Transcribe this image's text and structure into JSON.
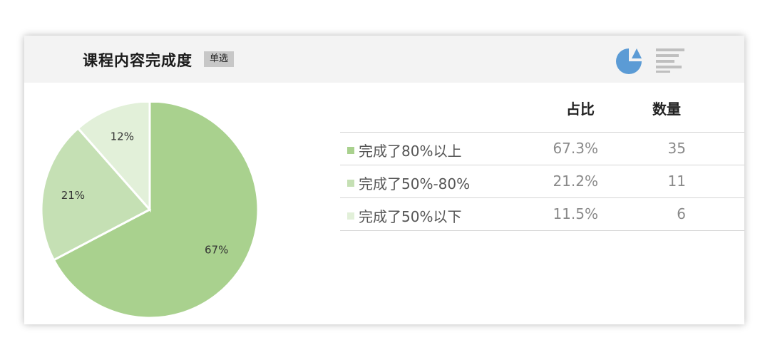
{
  "header": {
    "title": "课程内容完成度",
    "badge": "单选"
  },
  "icons": {
    "pie_view": "pie-chart-icon",
    "bar_view": "bar-list-icon",
    "accent": "#5b9bd5"
  },
  "table": {
    "col_pct": "占比",
    "col_count": "数量",
    "rows": [
      {
        "label": "完成了80%以上",
        "pct": "67.3%",
        "count": "35",
        "color": "#a9d18e"
      },
      {
        "label": "完成了50%-80%",
        "pct": "21.2%",
        "count": "11",
        "color": "#c5e0b4"
      },
      {
        "label": "完成了50%以下",
        "pct": "11.5%",
        "count": "6",
        "color": "#e2f0d9"
      }
    ]
  },
  "chart_data": {
    "type": "pie",
    "title": "课程内容完成度",
    "slices": [
      {
        "label": "完成了80%以上",
        "value": 67.3,
        "count": 35,
        "display": "67%",
        "color": "#a9d18e"
      },
      {
        "label": "完成了50%-80%",
        "value": 21.2,
        "count": 11,
        "display": "21%",
        "color": "#c5e0b4"
      },
      {
        "label": "完成了50%以下",
        "value": 11.5,
        "count": 6,
        "display": "12%",
        "color": "#e2f0d9"
      }
    ]
  }
}
